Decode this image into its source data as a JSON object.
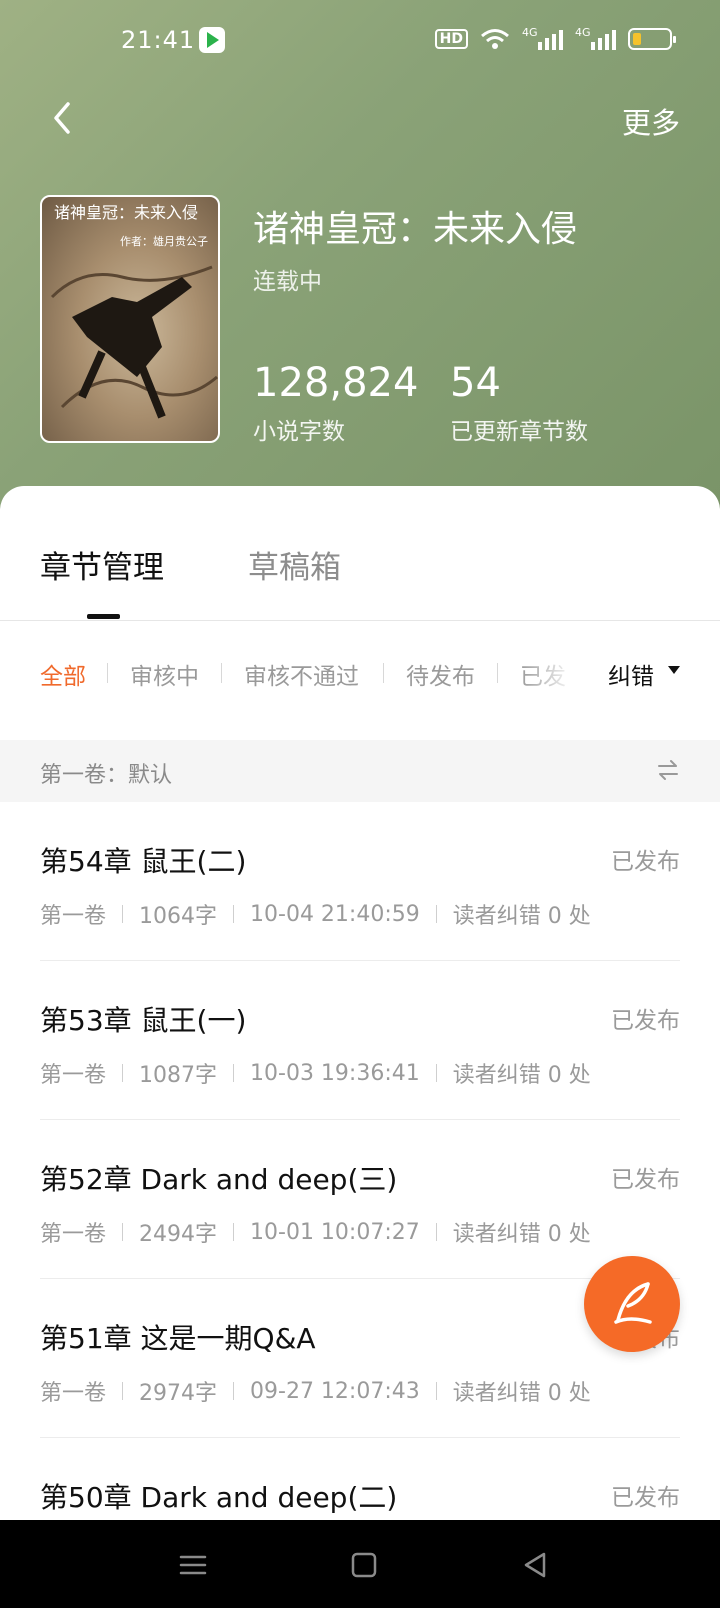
{
  "status_bar": {
    "time": "21:41",
    "hd_label": "HD",
    "net1": "4G",
    "net2": "4G",
    "battery_color": "#f5c22b"
  },
  "header": {
    "back_icon": "chevron-left-icon",
    "more_label": "更多"
  },
  "book": {
    "cover_title": "诸神皇冠：未来入侵",
    "cover_author": "作者：雄月贵公子",
    "title": "诸神皇冠：未来入侵",
    "status": "连载中",
    "word_count": "128,824",
    "word_count_label": "小说字数",
    "chapter_count": "54",
    "chapter_count_label": "已更新章节数"
  },
  "tabs": [
    {
      "label": "章节管理",
      "active": true
    },
    {
      "label": "草稿箱",
      "active": false
    }
  ],
  "filters": {
    "items": [
      "全部",
      "审核中",
      "审核不通过",
      "待发布",
      "已发"
    ],
    "active_color": "#f06a2c",
    "dropdown_label": "纠错"
  },
  "volume": {
    "label": "第一卷：默认"
  },
  "chapters": [
    {
      "title": "第54章 鼠王(二)",
      "status": "已发布",
      "volume": "第一卷",
      "words": "1064字",
      "time": "10-04 21:40:59",
      "errata": "读者纠错 0 处"
    },
    {
      "title": "第53章 鼠王(一)",
      "status": "已发布",
      "volume": "第一卷",
      "words": "1087字",
      "time": "10-03 19:36:41",
      "errata": "读者纠错 0 处"
    },
    {
      "title": "第52章 Dark and deep(三)",
      "status": "已发布",
      "volume": "第一卷",
      "words": "2494字",
      "time": "10-01 10:07:27",
      "errata": "读者纠错 0 处"
    },
    {
      "title": "第51章 这是一期Q&A",
      "status": "已发布",
      "volume": "第一卷",
      "words": "2974字",
      "time": "09-27 12:07:43",
      "errata": "读者纠错 0 处"
    },
    {
      "title": "第50章 Dark and deep(二)",
      "status": "已发布",
      "volume": "",
      "words": "",
      "time": "",
      "errata": ""
    }
  ],
  "fab": {
    "icon": "quill-pen-icon",
    "color": "#f56a27"
  },
  "nav": {
    "menu_icon": "menu-icon",
    "home_icon": "home-square-icon",
    "back_icon": "back-triangle-icon"
  }
}
